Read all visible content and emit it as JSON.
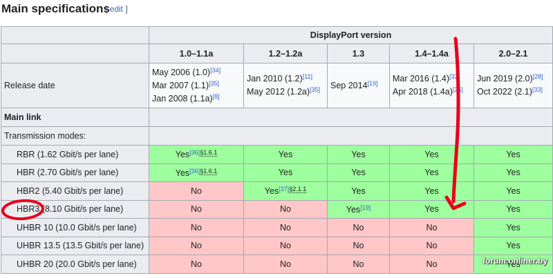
{
  "heading": "Main specifications",
  "edit": {
    "open": "[ ",
    "label": "edit",
    "close": " ]"
  },
  "table": {
    "group_header": "DisplayPort version",
    "versions": [
      "1.0–1.1a",
      "1.2–1.2a",
      "1.3",
      "1.4–1.4a",
      "2.0–2.1"
    ],
    "release": {
      "label": "Release date",
      "cells": [
        [
          {
            "text": "May 2006 (1.0)",
            "ref": "[34]"
          },
          {
            "text": "Mar 2007 (1.1)",
            "ref": "[35]"
          },
          {
            "text": "Jan 2008 (1.1a)",
            "ref": "[8]"
          }
        ],
        [
          {
            "text": "Jan 2010 (1.2)",
            "ref": "[11]"
          },
          {
            "text": "May 2012 (1.2a)",
            "ref": "[35]"
          }
        ],
        [
          {
            "text": "Sep 2014",
            "ref": "[19]"
          }
        ],
        [
          {
            "text": "Mar 2016 (1.4)",
            "ref": "[32]"
          },
          {
            "text": "Apr 2018 (1.4a)",
            "ref": "[25]"
          }
        ],
        [
          {
            "text": "Jun 2019 (2.0)",
            "ref": "[28]"
          },
          {
            "text": "Oct 2022 (2.1)",
            "ref": "[33]"
          }
        ]
      ]
    },
    "main_link": "Main link",
    "transmission_modes": "Transmission modes:",
    "modes": [
      {
        "label": "RBR (1.62 Gbit/s per lane)",
        "cells": [
          {
            "v": "Yes",
            "ref": "[36]",
            "sec": "§1.6.1"
          },
          {
            "v": "Yes"
          },
          {
            "v": "Yes"
          },
          {
            "v": "Yes"
          },
          {
            "v": "Yes"
          }
        ]
      },
      {
        "label": "HBR (2.70 Gbit/s per lane)",
        "cells": [
          {
            "v": "Yes",
            "ref": "[36]",
            "sec": "§1.6.1"
          },
          {
            "v": "Yes"
          },
          {
            "v": "Yes"
          },
          {
            "v": "Yes"
          },
          {
            "v": "Yes"
          }
        ]
      },
      {
        "label": "HBR2 (5.40 Gbit/s per lane)",
        "cells": [
          {
            "v": "No"
          },
          {
            "v": "Yes",
            "ref": "[37]",
            "sec": "§2.1.1"
          },
          {
            "v": "Yes"
          },
          {
            "v": "Yes"
          },
          {
            "v": "Yes"
          }
        ]
      },
      {
        "label": "HBR3 (8.10 Gbit/s per lane)",
        "cells": [
          {
            "v": "No"
          },
          {
            "v": "No"
          },
          {
            "v": "Yes",
            "ref": "[19]"
          },
          {
            "v": "Yes"
          },
          {
            "v": "Yes"
          }
        ]
      },
      {
        "label": "UHBR 10 (10.0 Gbit/s per lane)",
        "cells": [
          {
            "v": "No"
          },
          {
            "v": "No"
          },
          {
            "v": "No"
          },
          {
            "v": "No"
          },
          {
            "v": "Yes"
          }
        ]
      },
      {
        "label": "UHBR 13.5 (13.5 Gbit/s per lane)",
        "cells": [
          {
            "v": "No"
          },
          {
            "v": "No"
          },
          {
            "v": "No"
          },
          {
            "v": "No"
          },
          {
            "v": "Yes"
          }
        ]
      },
      {
        "label": "UHBR 20 (20.0 Gbit/s per lane)",
        "cells": [
          {
            "v": "No"
          },
          {
            "v": "No"
          },
          {
            "v": "No"
          },
          {
            "v": "No"
          },
          {
            "v": "Yes"
          }
        ]
      }
    ]
  },
  "watermark": "forum.onliner.by",
  "colors": {
    "yes": "#9eff9e",
    "no": "#ffc7c7",
    "header": "#eaecf0",
    "annotation": "#e8001c"
  }
}
